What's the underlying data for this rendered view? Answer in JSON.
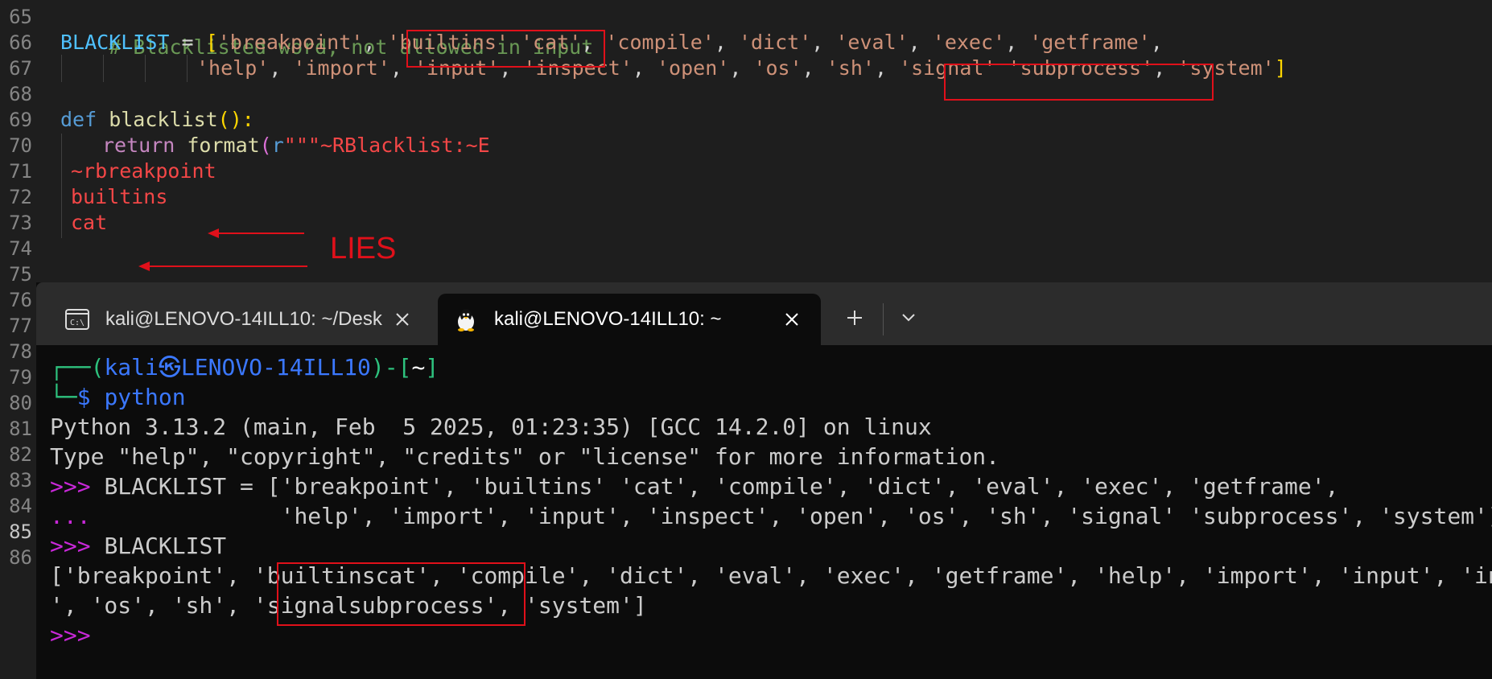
{
  "editor": {
    "line_numbers": [
      "65",
      "66",
      "67",
      "68",
      "69",
      "70",
      "71",
      "72",
      "73",
      "74",
      "75",
      "76",
      "77",
      "78",
      "79",
      "80",
      "81",
      "82",
      "83",
      "84",
      "85",
      "86"
    ],
    "active_line": "85",
    "line65": {
      "comment": "# Blacklisted word, not allowed in input"
    },
    "line66": {
      "var": "BLACKLIST",
      "op": " = ",
      "open": "[",
      "s1": "'breakpoint'",
      "sep1": ", ",
      "s2": "'builtins' 'cat'",
      "sep2": ", ",
      "s3": "'compile'",
      "sep3": ", ",
      "s4": "'dict'",
      "sep4": ", ",
      "s5": "'eval'",
      "sep5": ", ",
      "s6": "'exec'",
      "sep6": ", ",
      "s7": "'getframe'",
      "sep7": ","
    },
    "line67": {
      "s1": "'help'",
      "sep1": ", ",
      "s2": "'import'",
      "sep2": ", ",
      "s3": "'input'",
      "sep3": ", ",
      "s4": "'inspect'",
      "sep4": ", ",
      "s5": "'open'",
      "sep5": ", ",
      "s6": "'os'",
      "sep6": ", ",
      "s7": "'sh'",
      "sep7": ", ",
      "s8": "'signal' 'subprocess'",
      "sep8": ", ",
      "s9": "'system'",
      "close": "]"
    },
    "line69": {
      "kw": "def",
      "name": " blacklist",
      "parens": "():",
      "colon": ""
    },
    "line70": {
      "ret": "return",
      "fn": " format",
      "paren": "(",
      "prefix": "r",
      "str": "\"\"\"~RBlacklist:~E"
    },
    "line71": {
      "text": "~rbreakpoint"
    },
    "line72": {
      "text": "builtins"
    },
    "line73": {
      "text": "cat"
    }
  },
  "annotation": {
    "label": "LIES"
  },
  "terminal": {
    "tabs": [
      {
        "title": "kali@LENOVO-14ILL10: ~/Desk",
        "icon": "cmd-icon",
        "active": false
      },
      {
        "title": "kali@LENOVO-14ILL10: ~",
        "icon": "linux-penguin-icon",
        "active": true
      }
    ],
    "new_tab_icon": "plus-icon",
    "dropdown_icon": "chevron-down-icon",
    "prompt": {
      "corner_top": "┌──(",
      "user": "kali",
      "at_icon": "㉿",
      "host": "LENOVO-14ILL10",
      "mid": ")-[",
      "dir": "~",
      "end": "]",
      "corner_bottom": "└─",
      "dollar": "$ ",
      "command": "python"
    },
    "lines": {
      "version": "Python 3.13.2 (main, Feb  5 2025, 01:23:35) [GCC 14.2.0] on linux",
      "type_help": "Type \"help\", \"copyright\", \"credits\" or \"license\" for more information.",
      "ps1": ">>> ",
      "input1": "BLACKLIST = ['breakpoint', 'builtins' 'cat', 'compile', 'dict', 'eval', 'exec', 'getframe',",
      "ps2": "...",
      "input2": "              'help', 'import', 'input', 'inspect', 'open', 'os', 'sh', 'signal' 'subprocess', 'system']",
      "input3": "BLACKLIST",
      "output1": "['breakpoint', 'builtinscat', 'compile', 'dict', 'eval', 'exec', 'getframe', 'help', 'import', 'input', 'inspect', 'open'",
      "output2": "', 'os', 'sh', 'signalsubprocess', 'system']",
      "ps1_last": ">>>"
    }
  },
  "colors": {
    "editor_bg": "#1e1e1e",
    "terminal_bg": "#0c0c0c",
    "highlight_red": "#e0101a"
  }
}
